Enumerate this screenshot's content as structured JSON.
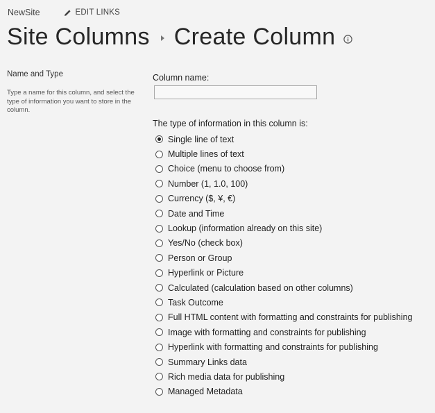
{
  "topbar": {
    "site_name": "NewSite",
    "edit_links_label": "EDIT LINKS"
  },
  "header": {
    "breadcrumb_parent": "Site Columns",
    "page_title": "Create Column"
  },
  "section": {
    "title": "Name and Type",
    "description": "Type a name for this column, and select the type of information you want to store in the column."
  },
  "form": {
    "column_name_label": "Column name:",
    "column_name_value": "",
    "type_label": "The type of information in this column is:",
    "options": [
      {
        "label": "Single line of text",
        "selected": true
      },
      {
        "label": "Multiple lines of text",
        "selected": false
      },
      {
        "label": "Choice (menu to choose from)",
        "selected": false
      },
      {
        "label": "Number (1, 1.0, 100)",
        "selected": false
      },
      {
        "label": "Currency ($, ¥, €)",
        "selected": false
      },
      {
        "label": "Date and Time",
        "selected": false
      },
      {
        "label": "Lookup (information already on this site)",
        "selected": false
      },
      {
        "label": "Yes/No (check box)",
        "selected": false
      },
      {
        "label": "Person or Group",
        "selected": false
      },
      {
        "label": "Hyperlink or Picture",
        "selected": false
      },
      {
        "label": "Calculated (calculation based on other columns)",
        "selected": false
      },
      {
        "label": "Task Outcome",
        "selected": false
      },
      {
        "label": "Full HTML content with formatting and constraints for publishing",
        "selected": false
      },
      {
        "label": "Image with formatting and constraints for publishing",
        "selected": false
      },
      {
        "label": "Hyperlink with formatting and constraints for publishing",
        "selected": false
      },
      {
        "label": "Summary Links data",
        "selected": false
      },
      {
        "label": "Rich media data for publishing",
        "selected": false
      },
      {
        "label": "Managed Metadata",
        "selected": false
      }
    ]
  },
  "icons": {
    "edit": "pencil-icon",
    "info": "info-icon",
    "breadcrumb_separator": "chevron-right-icon"
  }
}
